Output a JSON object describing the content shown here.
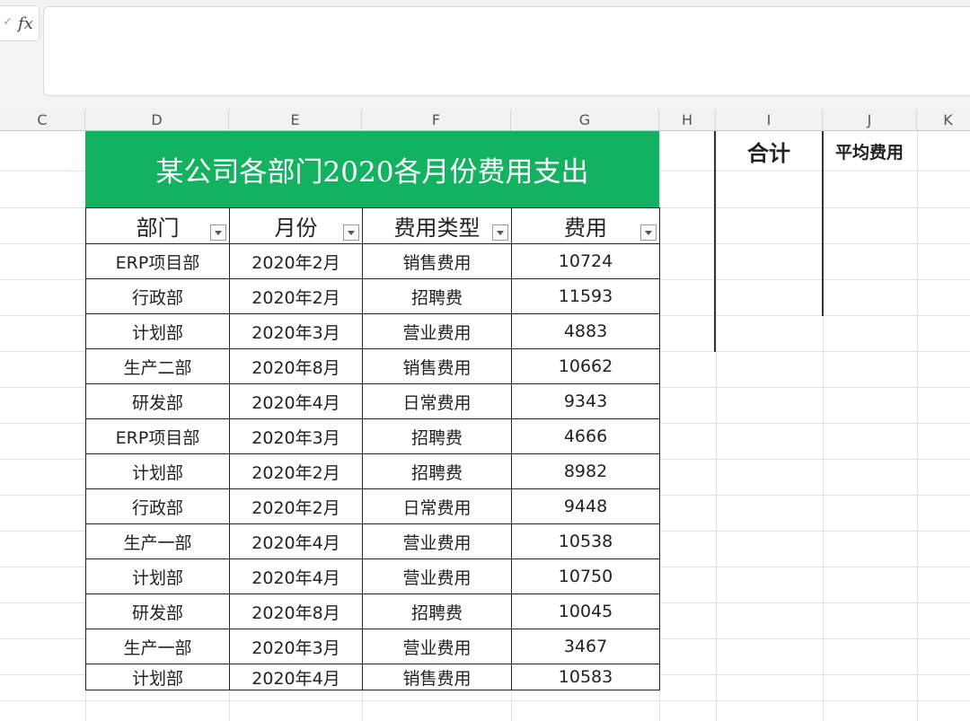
{
  "formula_bar": {
    "fx_label": "fx",
    "content": ""
  },
  "columns": [
    "C",
    "D",
    "E",
    "F",
    "G",
    "H",
    "I",
    "J",
    "K"
  ],
  "title": "某公司各部门2020各月份费用支出",
  "headers": [
    "部门",
    "月份",
    "费用类型",
    "费用"
  ],
  "rows": [
    [
      "ERP项目部",
      "2020年2月",
      "销售费用",
      "10724"
    ],
    [
      "行政部",
      "2020年2月",
      "招聘费",
      "11593"
    ],
    [
      "计划部",
      "2020年3月",
      "营业费用",
      "4883"
    ],
    [
      "生产二部",
      "2020年8月",
      "销售费用",
      "10662"
    ],
    [
      "研发部",
      "2020年4月",
      "日常费用",
      "9343"
    ],
    [
      "ERP项目部",
      "2020年3月",
      "招聘费",
      "4666"
    ],
    [
      "计划部",
      "2020年2月",
      "招聘费",
      "8982"
    ],
    [
      "行政部",
      "2020年2月",
      "日常费用",
      "9448"
    ],
    [
      "生产一部",
      "2020年4月",
      "营业费用",
      "10538"
    ],
    [
      "计划部",
      "2020年4月",
      "营业费用",
      "10750"
    ],
    [
      "研发部",
      "2020年8月",
      "招聘费",
      "10045"
    ],
    [
      "生产一部",
      "2020年3月",
      "营业费用",
      "3467"
    ],
    [
      "计划部",
      "2020年4月",
      "销售费用",
      "10583"
    ]
  ],
  "summary": {
    "total_label": "合计",
    "average_label": "平均费用"
  }
}
